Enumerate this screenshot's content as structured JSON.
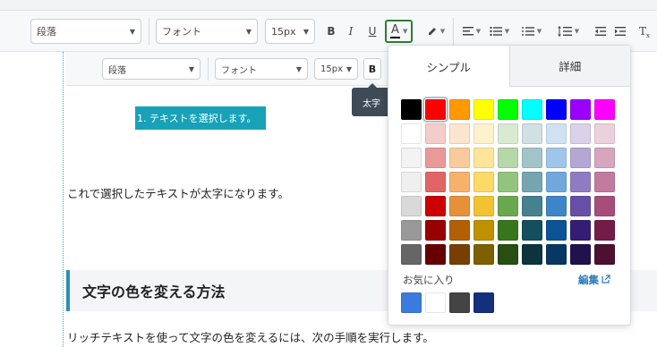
{
  "toolbar": {
    "paragraph_select": "段落",
    "font_select": "フォント",
    "size_select": "15px",
    "bold": "B",
    "italic": "I",
    "underline": "U",
    "font_color": "A",
    "clear_format": "T"
  },
  "inner_toolbar": {
    "paragraph_select": "段落",
    "font_select": "フォント",
    "size_select": "15px",
    "bold": "B"
  },
  "tooltip": "太字",
  "content": {
    "selected_item": "1. テキストを選択します。",
    "para1": "これで選択したテキストが太字になります。",
    "heading": "文字の色を変える方法",
    "para2": "リッチテキストを使って文字の色を変えるには、次の手順を実行します。"
  },
  "color_picker": {
    "tabs": [
      "シンプル",
      "詳細"
    ],
    "active_tab": "シンプル",
    "selected_color": "#ff0000",
    "palette": [
      [
        "#000000",
        "#ff0000",
        "#ff9900",
        "#ffff00",
        "#00ff00",
        "#00ffff",
        "#0000ff",
        "#9900ff",
        "#ff00ff"
      ],
      [
        "#ffffff",
        "#f4cccc",
        "#fce5cd",
        "#fff2cc",
        "#d9ead3",
        "#d0e0e3",
        "#cfe2f3",
        "#d9d2e9",
        "#ead1dc"
      ],
      [
        "#f3f3f3",
        "#ea9999",
        "#f9cb9c",
        "#ffe599",
        "#b6d7a8",
        "#a2c4c9",
        "#9fc5e8",
        "#b4a7d6",
        "#d5a6bd"
      ],
      [
        "#efefef",
        "#e06666",
        "#f6b26b",
        "#ffd966",
        "#93c47d",
        "#76a5af",
        "#6fa8dc",
        "#8e7cc3",
        "#c27ba0"
      ],
      [
        "#d9d9d9",
        "#cc0000",
        "#e69138",
        "#f1c232",
        "#6aa84f",
        "#45818e",
        "#3d85c6",
        "#674ea7",
        "#a64d79"
      ],
      [
        "#999999",
        "#990000",
        "#b45f06",
        "#bf9000",
        "#38761d",
        "#134f5c",
        "#0b5394",
        "#351c75",
        "#741b47"
      ],
      [
        "#666666",
        "#660000",
        "#783f04",
        "#7f6000",
        "#274e13",
        "#0c343d",
        "#073763",
        "#20124d",
        "#4c1130"
      ]
    ],
    "favorites_label": "お気に入り",
    "edit_label": "編集",
    "favorites": [
      "#3a7bde",
      "#ffffff",
      "#444444",
      "#13307d"
    ]
  }
}
